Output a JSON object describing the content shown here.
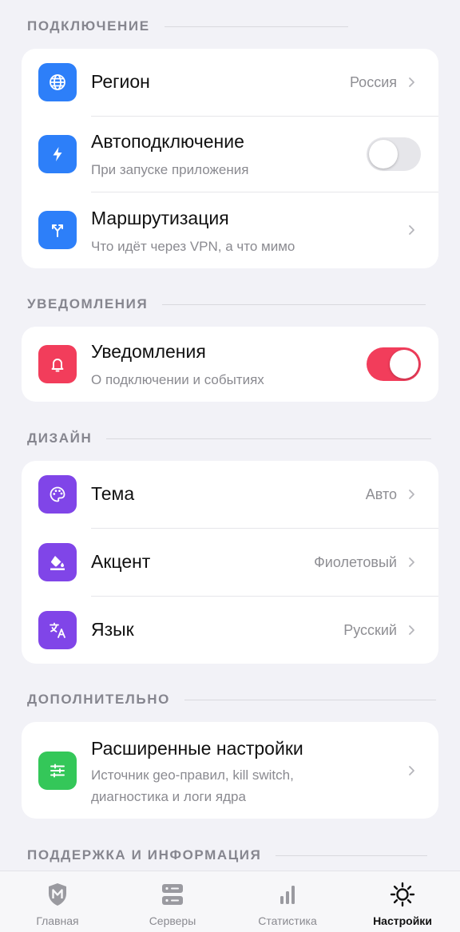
{
  "colors": {
    "background": "#f2f2f7",
    "blue": "#2d7ff9",
    "red": "#f23d5b",
    "purple": "#8045e8",
    "green": "#34c759",
    "toggle_off": "#e6e6ea"
  },
  "sections": {
    "connection": {
      "title": "ПОДКЛЮЧЕНИЕ",
      "region": {
        "title": "Регион",
        "value": "Россия",
        "icon": "globe-icon"
      },
      "autoconnect": {
        "title": "Автоподключение",
        "subtitle": "При запуске приложения",
        "icon": "lightning-icon",
        "enabled": false
      },
      "routing": {
        "title": "Маршрутизация",
        "subtitle": "Что идёт через VPN, а что мимо",
        "icon": "split-arrows-icon"
      }
    },
    "notifications": {
      "title": "УВЕДОМЛЕНИЯ",
      "notifications": {
        "title": "Уведомления",
        "subtitle": "О подключении и событиях",
        "icon": "bell-icon",
        "enabled": true
      }
    },
    "design": {
      "title": "ДИЗАЙН",
      "theme": {
        "title": "Тема",
        "value": "Авто",
        "icon": "palette-icon"
      },
      "accent": {
        "title": "Акцент",
        "value": "Фиолетовый",
        "icon": "paint-bucket-icon"
      },
      "language": {
        "title": "Язык",
        "value": "Русский",
        "icon": "translate-icon"
      }
    },
    "advanced": {
      "title": "ДОПОЛНИТЕЛЬНО",
      "advanced_settings": {
        "title": "Расширенные настройки",
        "subtitle_line1": "Источник geo-правил, kill switch,",
        "subtitle_line2": "диагностика и логи ядра",
        "icon": "sliders-icon"
      }
    },
    "support": {
      "title": "ПОДДЕРЖКА И ИНФОРМАЦИЯ"
    }
  },
  "tabbar": {
    "tabs": [
      {
        "label": "Главная",
        "icon": "shield-logo-icon",
        "active": false
      },
      {
        "label": "Серверы",
        "icon": "servers-icon",
        "active": false
      },
      {
        "label": "Статистика",
        "icon": "bar-chart-icon",
        "active": false
      },
      {
        "label": "Настройки",
        "icon": "gear-icon",
        "active": true
      }
    ]
  }
}
